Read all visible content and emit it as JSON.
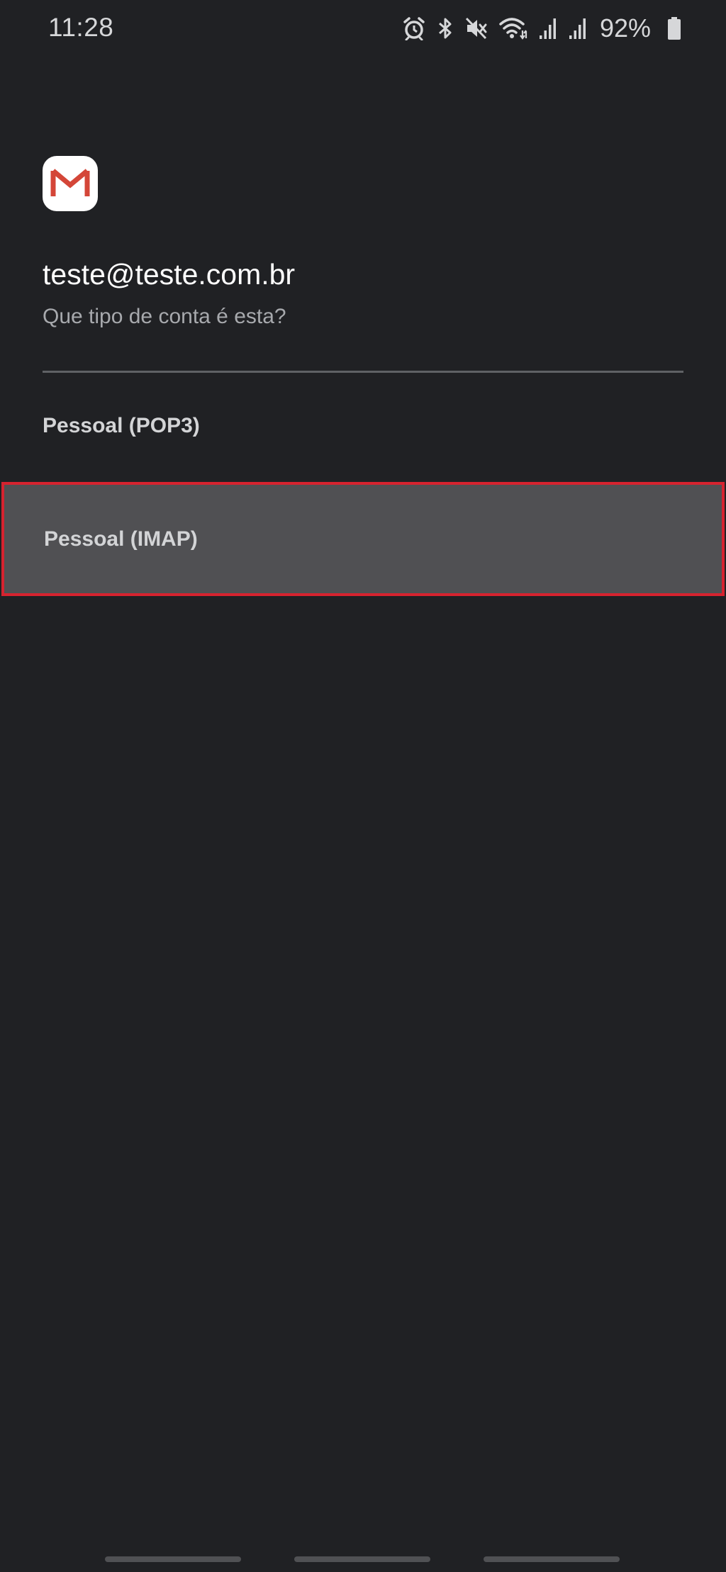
{
  "status_bar": {
    "time": "11:28",
    "battery_percent": "92%",
    "icons": [
      "alarm-icon",
      "bluetooth-icon",
      "mute-icon",
      "wifi-icon",
      "signal-icon",
      "signal-icon",
      "battery-icon"
    ]
  },
  "account": {
    "app_icon": "gmail-icon",
    "email": "teste@teste.com.br",
    "question": "Que tipo de conta é esta?"
  },
  "options": [
    {
      "label": "Pessoal (POP3)",
      "selected": false
    },
    {
      "label": "Pessoal (IMAP)",
      "selected": true
    }
  ],
  "navigation": {
    "items": [
      "recent-apps",
      "home",
      "back"
    ]
  },
  "colors": {
    "background": "#202124",
    "highlight": "#505053",
    "highlight_border": "#d6232f",
    "gmail_red": "#d44638"
  }
}
